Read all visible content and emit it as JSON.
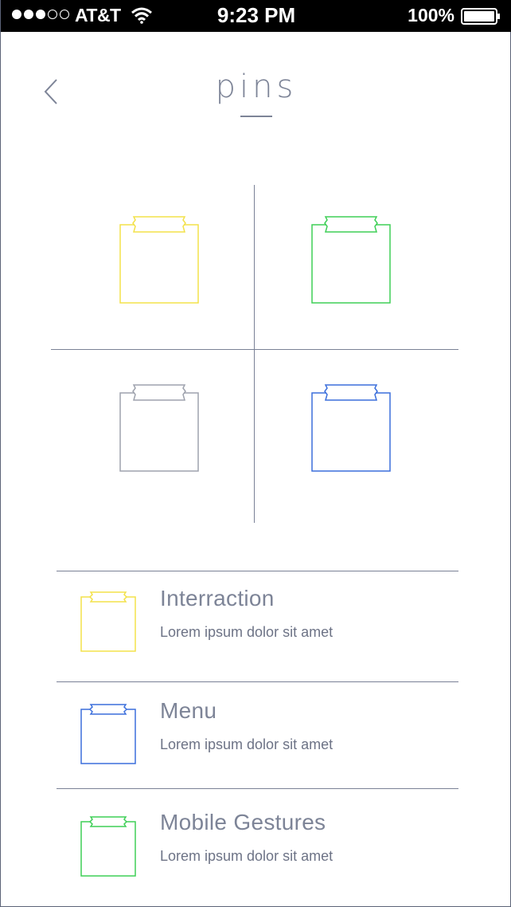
{
  "status_bar": {
    "carrier": "AT&T",
    "time": "9:23 PM",
    "battery": "100%",
    "signal_icon": "signal-dots-icon",
    "wifi_icon": "wifi-icon",
    "battery_icon": "battery-icon"
  },
  "header": {
    "title": "pins",
    "back_icon": "chevron-left-icon"
  },
  "grid": {
    "tiles": [
      {
        "color": "#f3e24a",
        "icon": "pin-note-icon"
      },
      {
        "color": "#3fcf57",
        "icon": "pin-note-icon"
      },
      {
        "color": "#9ea2ad",
        "icon": "pin-note-icon"
      },
      {
        "color": "#3b6fdc",
        "icon": "pin-note-icon"
      }
    ]
  },
  "list": {
    "items": [
      {
        "title": "Interraction",
        "subtitle": "Lorem ipsum dolor sit amet",
        "color": "#f3e24a",
        "icon": "pin-note-icon"
      },
      {
        "title": "Menu",
        "subtitle": "Lorem ipsum dolor sit amet",
        "color": "#3b6fdc",
        "icon": "pin-note-icon"
      },
      {
        "title": "Mobile Gestures",
        "subtitle": "Lorem ipsum dolor sit amet",
        "color": "#3fcf57",
        "icon": "pin-note-icon"
      }
    ]
  }
}
